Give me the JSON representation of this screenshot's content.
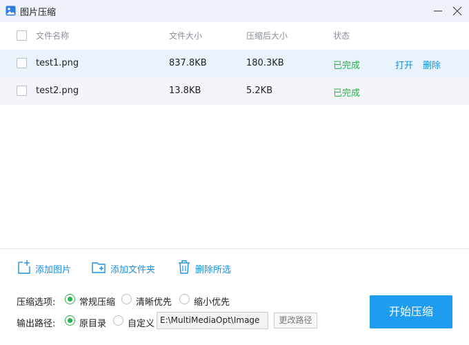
{
  "window": {
    "title": "图片压缩"
  },
  "table": {
    "headers": {
      "name": "文件名称",
      "size": "文件大小",
      "compressed": "压缩后大小",
      "status": "状态"
    },
    "rows": [
      {
        "name": "test1.png",
        "size": "837.8KB",
        "compressed": "180.3KB",
        "status": "已完成",
        "open": "打开",
        "delete": "删除"
      },
      {
        "name": "test2.png",
        "size": "13.8KB",
        "compressed": "5.2KB",
        "status": "已完成"
      }
    ]
  },
  "toolbar": {
    "add_image": "添加图片",
    "add_folder": "添加文件夹",
    "delete_selected": "删除所选"
  },
  "options": {
    "compress_label": "压缩选项:",
    "compress_modes": [
      "常规压缩",
      "清晰优先",
      "缩小优先"
    ],
    "compress_selected": "常规压缩",
    "output_label": "输出路径:",
    "output_modes": [
      "原目录",
      "自定义"
    ],
    "output_selected": "原目录",
    "output_path": "E:\\MultiMediaOpt\\Image",
    "change_path": "更改路径"
  },
  "start_button": "开始压缩",
  "colors": {
    "accent": "#1e9cf0",
    "success": "#2bb24c",
    "selected_row": "#e9f3fd"
  }
}
